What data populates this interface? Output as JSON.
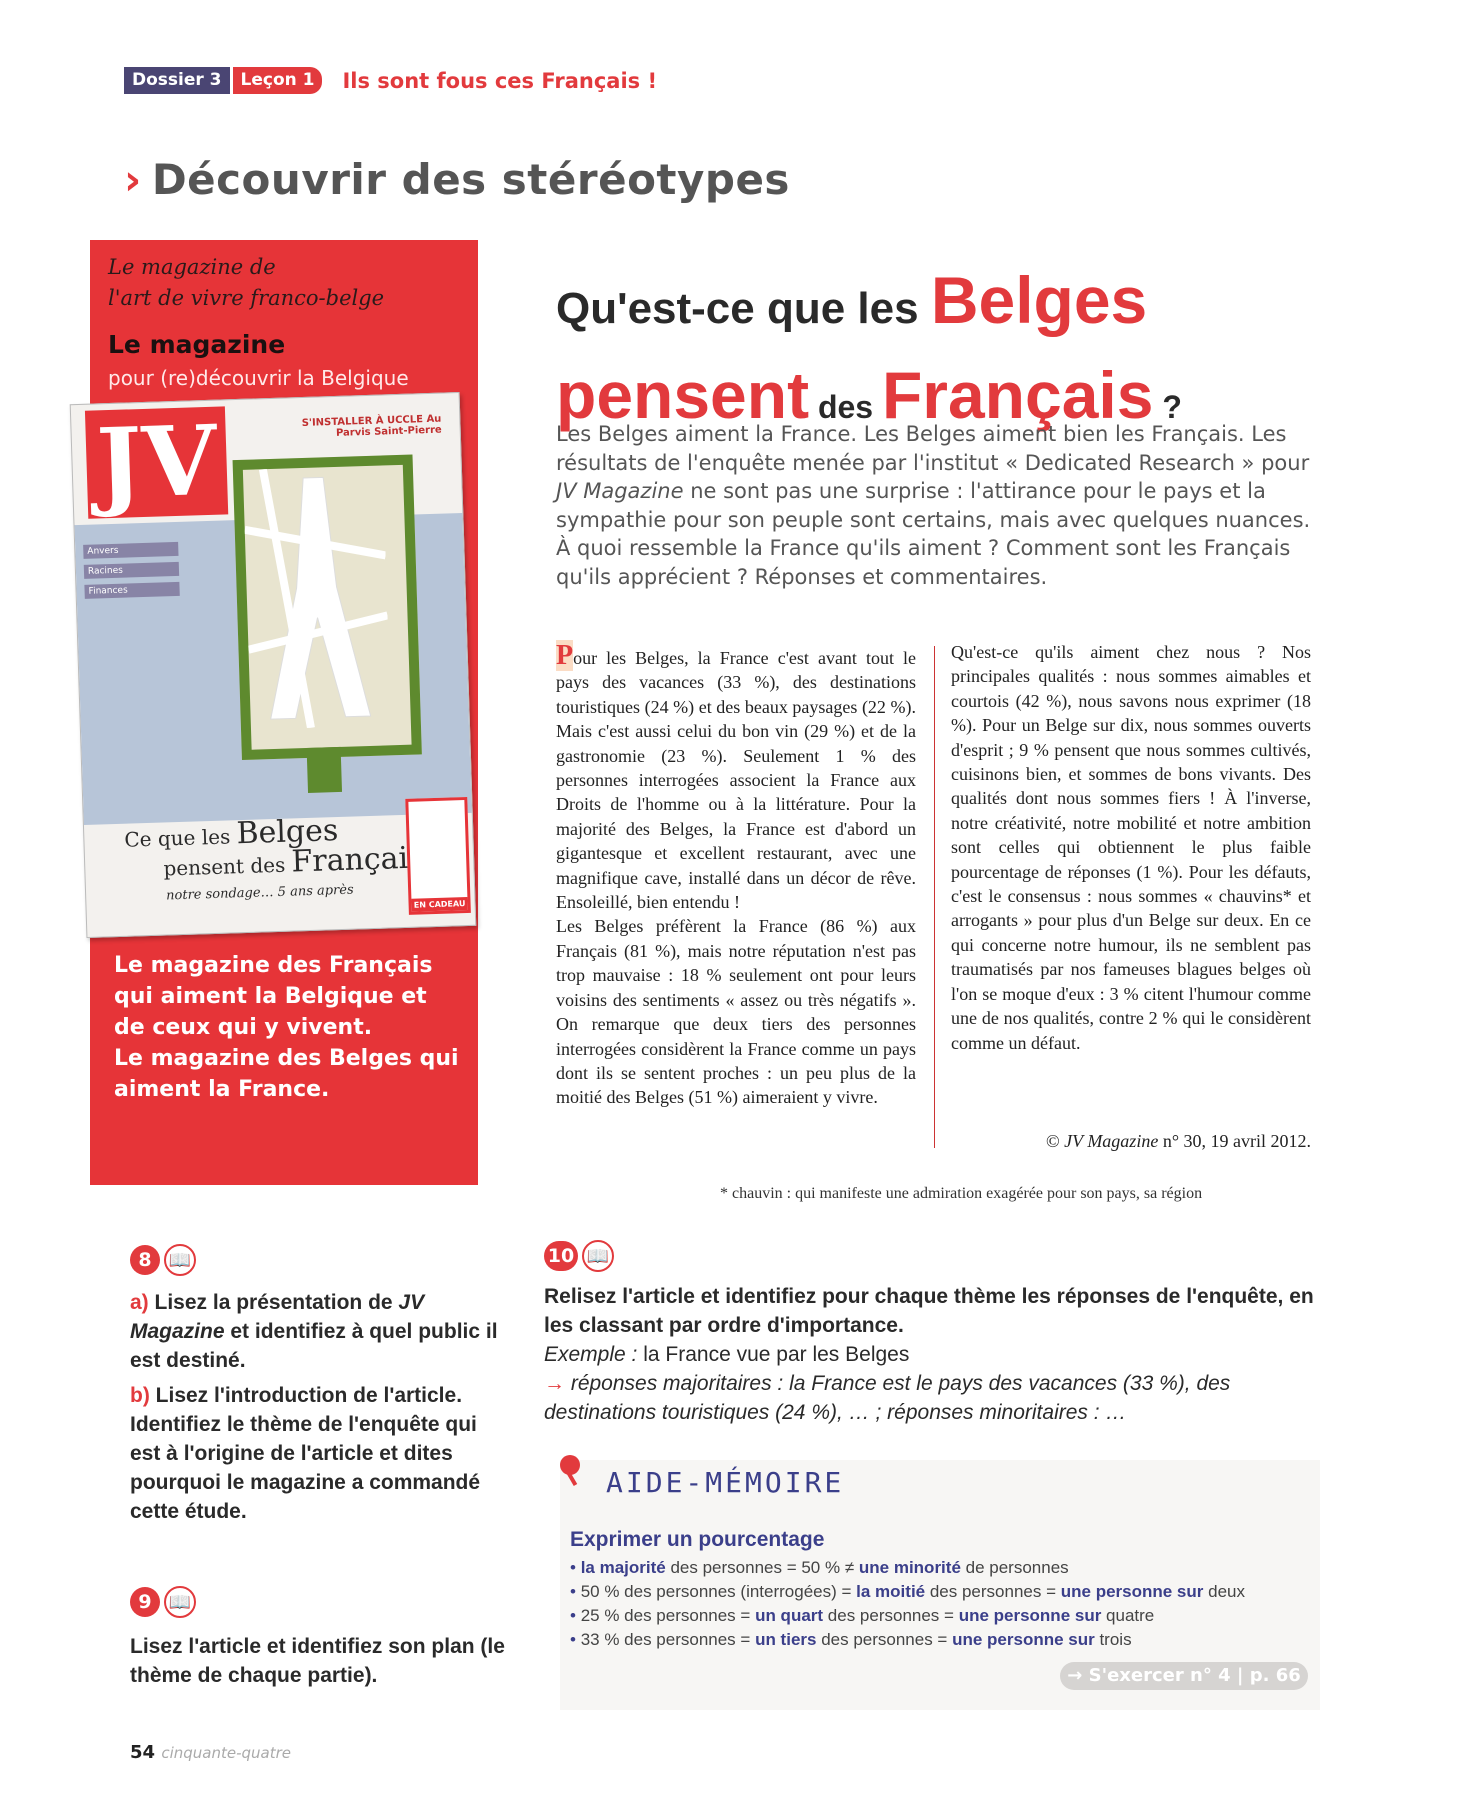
{
  "header": {
    "dossier": "Dossier 3",
    "lecon": "Leçon 1",
    "title": "Ils sont fous ces Français !"
  },
  "section": {
    "chevron": "›",
    "title": "Découvrir des stéréotypes"
  },
  "ad": {
    "line1": "Le magazine de",
    "line2": "l'art de vivre franco-belge",
    "magazine": "Le magazine",
    "sub": "pour (re)découvrir la Belgique",
    "foot1": "Le magazine des Français qui aiment la Belgique et de ceux qui y vivent.",
    "foot2": "Le magazine des Belges qui aiment la France."
  },
  "cover": {
    "logo": "JV",
    "top": "S'INSTALLER À UCCLE Au Parvis Saint-Pierre",
    "side": [
      "Anvers",
      "Racines",
      "Finances"
    ],
    "title1": "Ce que les",
    "title2": "Belges",
    "title3": "pensent des",
    "title4": "Français",
    "title5": "notre sondage… 5 ans après",
    "badge": "EN CADEAU"
  },
  "article": {
    "h_part1": "Qu'est-ce que les ",
    "h_part2": "Belges",
    "h_part3": "pensent",
    "h_part4": " des ",
    "h_part5": "Français",
    "h_part6": " ?",
    "intro_a": "Les Belges aiment la France. Les Belges aiment bien les Français. Les résultats de l'enquête menée par l'institut « Dedicated Research » pour ",
    "intro_mag": "JV Magazine",
    "intro_b": " ne sont pas une surprise : l'attirance pour le pays et la sympathie pour son peuple sont certains, mais avec quelques nuances. À quoi ressemble la France qu'ils aiment ? Comment sont les Français qu'ils apprécient ? Réponses et commentaires.",
    "col1_drop": "P",
    "col1_p1": "our les Belges, la France c'est avant tout le pays des vacances (33 %), des destinations touristiques (24 %) et des beaux paysages (22 %). Mais c'est aussi celui du bon vin (29 %) et de la gastronomie (23 %). Seulement 1 % des personnes interrogées associent la France aux Droits de l'homme ou à la littérature. Pour la majorité des Belges, la France est d'abord un gigantesque et excellent restaurant, avec une magnifique cave, installé dans un décor de rêve. Ensoleillé, bien entendu !",
    "col1_p2": "Les Belges préfèrent la France (86 %) aux Français (81 %), mais notre réputation n'est pas trop mauvaise : 18 % seulement ont pour leurs voisins des sentiments « assez ou très négatifs ». On remarque que deux tiers des personnes interrogées considèrent la France comme un pays dont ils se sentent proches : un peu plus de la moitié des Belges (51 %) aimeraient y vivre.",
    "col2_p1": "Qu'est-ce qu'ils aiment chez nous ? Nos principales qualités : nous sommes aimables et courtois (42 %), nous savons nous exprimer (18 %). Pour un Belge sur dix, nous sommes ouverts d'esprit ; 9 % pensent que nous sommes cultivés, cuisinons bien, et sommes de bons vivants. Des qualités dont nous sommes fiers ! À l'inverse, notre créativité, notre mobilité et notre ambition sont celles qui obtiennent le plus faible pourcentage de réponses (1 %). Pour les défauts, c'est le consensus : nous sommes « chauvins* et arrogants » pour plus d'un Belge sur deux. En ce qui concerne notre humour, ils ne semblent pas traumatisés par nos fameuses blagues belges où l'on se moque d'eux : 3 % citent l'humour comme une de nos qualités, contre 2 % qui le considèrent comme un défaut.",
    "credit_a": "© ",
    "credit_mag": "JV Magazine",
    "credit_b": " n° 30, 19 avril 2012.",
    "footnote": "* chauvin : qui manifeste une admiration exagérée pour son pays, sa région"
  },
  "ex8": {
    "num": "8",
    "book_icon": "📖",
    "a_letter": "a)",
    "a_text1": " Lisez la présentation de ",
    "a_mag": "JV Magazine",
    "a_text2": " et identifiez à quel public il est destiné.",
    "b_letter": "b)",
    "b_text": " Lisez l'introduction de l'article. Identifiez le thème de l'enquête qui est à l'origine de l'article et dites pourquoi le magazine a commandé cette étude."
  },
  "ex9": {
    "num": "9",
    "book_icon": "📖",
    "text": "Lisez l'article et identifiez son plan (le thème de chaque partie)."
  },
  "ex10": {
    "num": "10",
    "book_icon": "📖",
    "text": "Relisez l'article et identifiez pour chaque thème les réponses de l'enquête, en les classant par ordre d'importance.",
    "ex_label": "Exemple :",
    "ex_text": " la France vue par les Belges",
    "arrow": "→",
    "answer": " réponses majoritaires : la France est le pays des vacances (33 %), des destinations touristiques (24 %), … ; réponses minoritaires : …"
  },
  "aide": {
    "title": "AIDE-MÉMOIRE",
    "sub": "Exprimer un pourcentage",
    "items": [
      {
        "a": "",
        "b": "la majorité",
        "c": " des personnes = 50 % ≠ ",
        "d": "une minorité",
        "e": " de personnes"
      },
      {
        "a": "50 % des personnes (interrogées) = ",
        "b": "la moitié",
        "c": " des personnes = ",
        "d": "une personne sur",
        "e": " deux"
      },
      {
        "a": "25 % des personnes = ",
        "b": "un quart",
        "c": " des personnes = ",
        "d": "une personne sur",
        "e": " quatre"
      },
      {
        "a": "33 % des personnes = ",
        "b": "un tiers",
        "c": " des personnes = ",
        "d": "une personne sur",
        "e": " trois"
      }
    ],
    "link": "→ S'exercer n° 4 | p. 66"
  },
  "page": {
    "number": "54",
    "word": "cinquante-quatre"
  }
}
